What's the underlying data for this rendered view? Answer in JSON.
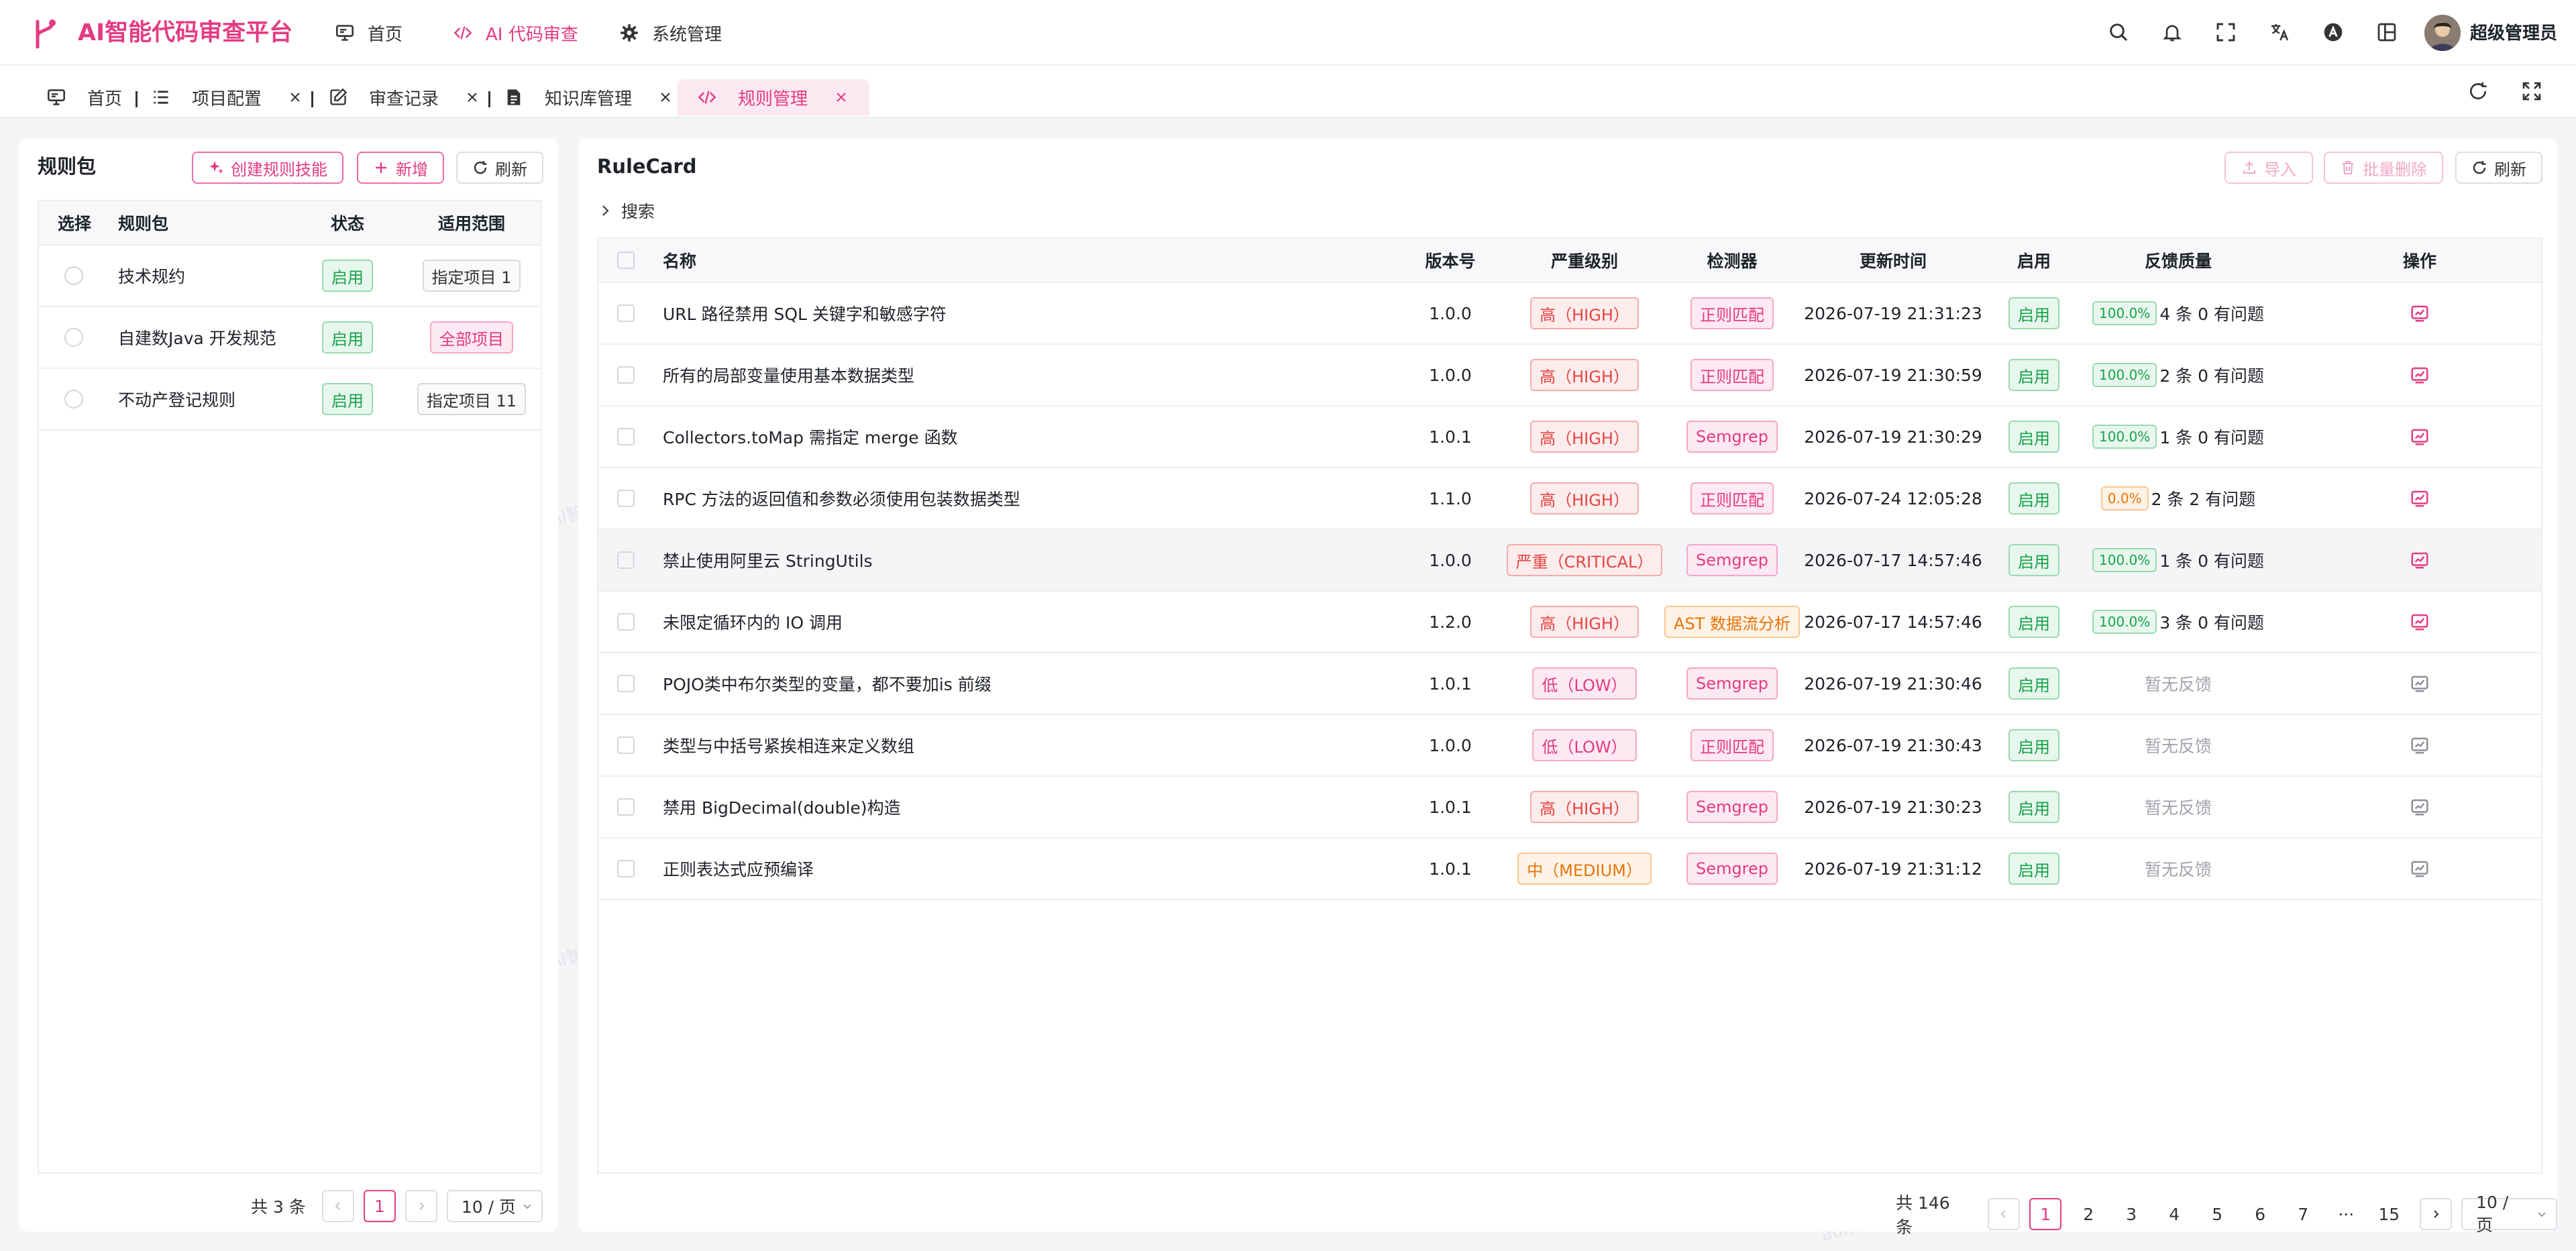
{
  "brand": "AI智能代码审查平台",
  "nav": [
    {
      "label": "首页",
      "icon": "monitor-icon"
    },
    {
      "label": "AI 代码审查",
      "icon": "code-icon"
    },
    {
      "label": "系统管理",
      "icon": "gear-icon"
    }
  ],
  "user": {
    "name": "超级管理员"
  },
  "tabs": [
    {
      "label": "首页",
      "icon": "monitor-icon"
    },
    {
      "label": "项目配置",
      "icon": "list-icon"
    },
    {
      "label": "审查记录",
      "icon": "edit-icon"
    },
    {
      "label": "知识库管理",
      "icon": "document-icon"
    },
    {
      "label": "规则管理",
      "icon": "code-icon"
    }
  ],
  "watermark": "admin@AI智能代码审查平台",
  "left": {
    "title": "规则包",
    "create_skill": "创建规则技能",
    "add": "新增",
    "refresh": "刷新",
    "headers": [
      "选择",
      "规则包",
      "状态",
      "适用范围"
    ],
    "rows": [
      {
        "name": "技术规约",
        "status": "启用",
        "scope": "指定项目 1",
        "scope_style": "gray"
      },
      {
        "name": "自建数Java 开发规范",
        "status": "启用",
        "scope": "全部项目",
        "scope_style": "pink"
      },
      {
        "name": "不动产登记规则",
        "status": "启用",
        "scope": "指定项目 11",
        "scope_style": "gray"
      }
    ],
    "total": "共 3 条",
    "page": "1",
    "page_size": "10 / 页"
  },
  "right": {
    "title": "RuleCard",
    "import": "导入",
    "batch_delete": "批量删除",
    "refresh": "刷新",
    "search": "搜索",
    "headers": [
      "名称",
      "版本号",
      "严重级别",
      "检测器",
      "更新时间",
      "启用",
      "反馈质量",
      "操作"
    ],
    "rows": [
      {
        "name": "URL 路径禁用 SQL 关键字和敏感字符",
        "version": "1.0.0",
        "severity": "高（HIGH）",
        "sev_style": "red",
        "detector": "正则匹配",
        "det_style": "pink",
        "updated": "2026-07-19 21:31:23",
        "enabled": "启用",
        "quality": "100.0%",
        "q_style": "green",
        "feedback": "4 条 0 有问题"
      },
      {
        "name": "所有的局部变量使用基本数据类型",
        "version": "1.0.0",
        "severity": "高（HIGH）",
        "sev_style": "red",
        "detector": "正则匹配",
        "det_style": "pink",
        "updated": "2026-07-19 21:30:59",
        "enabled": "启用",
        "quality": "100.0%",
        "q_style": "green",
        "feedback": "2 条 0 有问题"
      },
      {
        "name": "Collectors.toMap 需指定 merge 函数",
        "version": "1.0.1",
        "severity": "高（HIGH）",
        "sev_style": "red",
        "detector": "Semgrep",
        "det_style": "pink",
        "updated": "2026-07-19 21:30:29",
        "enabled": "启用",
        "quality": "100.0%",
        "q_style": "green",
        "feedback": "1 条 0 有问题"
      },
      {
        "name": "RPC 方法的返回值和参数必须使用包装数据类型",
        "version": "1.1.0",
        "severity": "高（HIGH）",
        "sev_style": "red",
        "detector": "正则匹配",
        "det_style": "pink",
        "updated": "2026-07-24 12:05:28",
        "enabled": "启用",
        "quality": "0.0%",
        "q_style": "orange",
        "feedback": "2 条 2 有问题"
      },
      {
        "name": "禁止使用阿里云 StringUtils",
        "version": "1.0.0",
        "severity": "严重（CRITICAL）",
        "sev_style": "red",
        "detector": "Semgrep",
        "det_style": "pink",
        "updated": "2026-07-17 14:57:46",
        "enabled": "启用",
        "quality": "100.0%",
        "q_style": "green",
        "feedback": "1 条 0 有问题"
      },
      {
        "name": "未限定循环内的 IO 调用",
        "version": "1.2.0",
        "severity": "高（HIGH）",
        "sev_style": "red",
        "detector": "AST 数据流分析",
        "det_style": "orange",
        "updated": "2026-07-17 14:57:46",
        "enabled": "启用",
        "quality": "100.0%",
        "q_style": "green",
        "feedback": "3 条 0 有问题"
      },
      {
        "name": "POJO类中布尔类型的变量，都不要加is 前缀",
        "version": "1.0.1",
        "severity": "低（LOW）",
        "sev_style": "pink",
        "detector": "Semgrep",
        "det_style": "pink",
        "updated": "2026-07-19 21:30:46",
        "enabled": "启用",
        "quality": "",
        "q_style": "",
        "feedback": "暂无反馈"
      },
      {
        "name": "类型与中括号紧挨相连来定义数组",
        "version": "1.0.0",
        "severity": "低（LOW）",
        "sev_style": "pink",
        "detector": "正则匹配",
        "det_style": "pink",
        "updated": "2026-07-19 21:30:43",
        "enabled": "启用",
        "quality": "",
        "q_style": "",
        "feedback": "暂无反馈"
      },
      {
        "name": "禁用 BigDecimal(double)构造",
        "version": "1.0.1",
        "severity": "高（HIGH）",
        "sev_style": "red",
        "detector": "Semgrep",
        "det_style": "pink",
        "updated": "2026-07-19 21:30:23",
        "enabled": "启用",
        "quality": "",
        "q_style": "",
        "feedback": "暂无反馈"
      },
      {
        "name": "正则表达式应预编译",
        "version": "1.0.1",
        "severity": "中（MEDIUM）",
        "sev_style": "orange",
        "detector": "Semgrep",
        "det_style": "pink",
        "updated": "2026-07-19 21:31:12",
        "enabled": "启用",
        "quality": "",
        "q_style": "",
        "feedback": "暂无反馈"
      }
    ],
    "total": "共 146 条",
    "pages": [
      "1",
      "2",
      "3",
      "4",
      "5",
      "6",
      "7",
      "···",
      "15"
    ],
    "page_size": "10 / 页"
  },
  "colors": {
    "accent": "#e43b83",
    "success": "#17a34a",
    "warning": "#e8740a",
    "danger": "#e54545"
  }
}
